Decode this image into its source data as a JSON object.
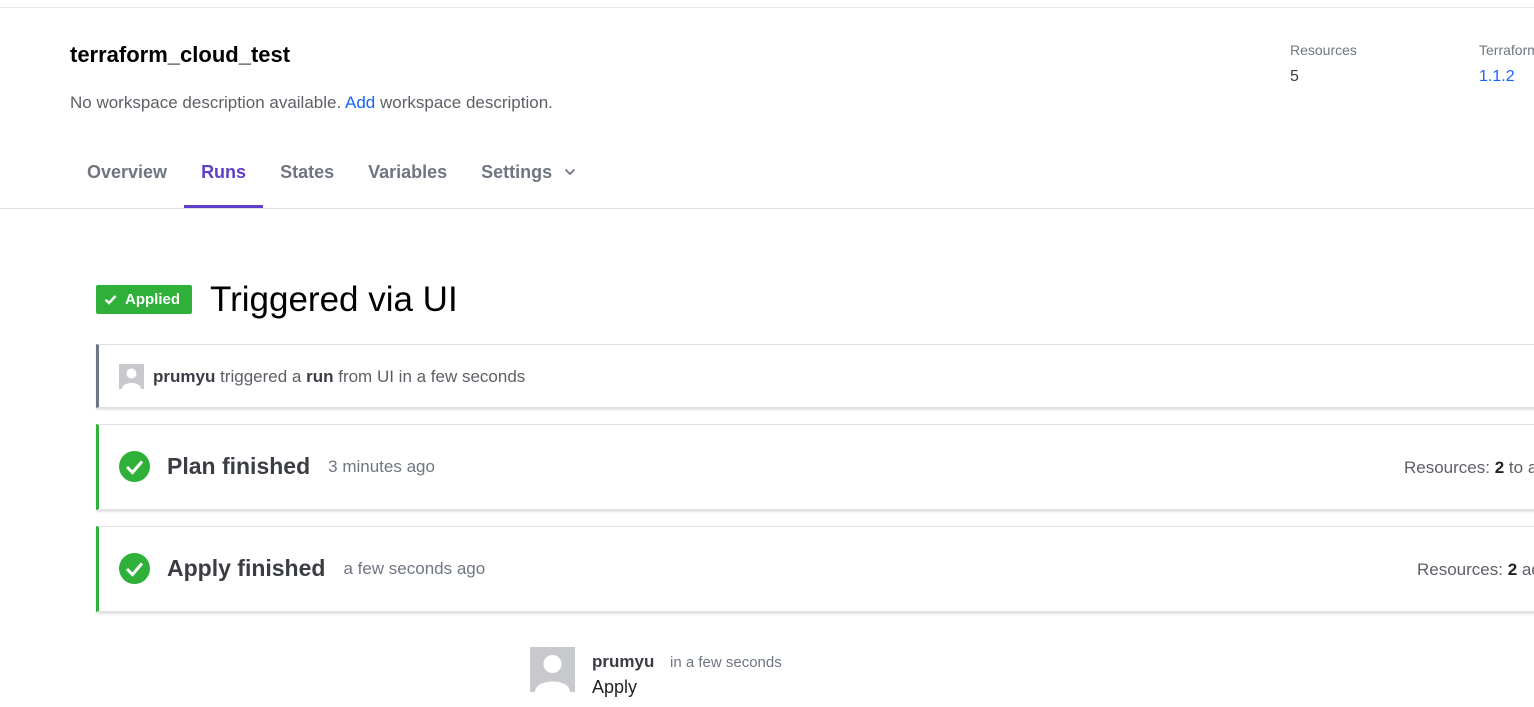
{
  "workspace": {
    "title": "terraform_cloud_test",
    "description_prefix": "No workspace description available.",
    "description_link": "Add",
    "description_suffix": "workspace description."
  },
  "meta": {
    "resources_label": "Resources",
    "resources_value": "5",
    "terraform_label": "Terraform",
    "terraform_value": "1.1.2"
  },
  "tabs": [
    {
      "label": "Overview",
      "active": false
    },
    {
      "label": "Runs",
      "active": true
    },
    {
      "label": "States",
      "active": false
    },
    {
      "label": "Variables",
      "active": false
    },
    {
      "label": "Settings",
      "active": false,
      "icon": "chevron-down-icon"
    }
  ],
  "run": {
    "status_badge": "Applied",
    "title": "Triggered via UI",
    "trigger": {
      "user": "prumyu",
      "text1": "triggered a",
      "run_word": "run",
      "text2": "from UI in a few seconds"
    },
    "plan": {
      "title": "Plan finished",
      "time": "3 minutes ago",
      "resources_label": "Resources:",
      "resources_count": "2",
      "resources_suffix": "to add"
    },
    "apply": {
      "title": "Apply finished",
      "time": "a few seconds ago",
      "resources_label": "Resources:",
      "resources_count": "2",
      "resources_suffix": "added"
    },
    "comment": {
      "user": "prumyu",
      "time": "in a few seconds",
      "body": "Apply"
    }
  },
  "colors": {
    "accent": "#5f3fc7",
    "success": "#2eb039",
    "link": "#1563ff"
  }
}
